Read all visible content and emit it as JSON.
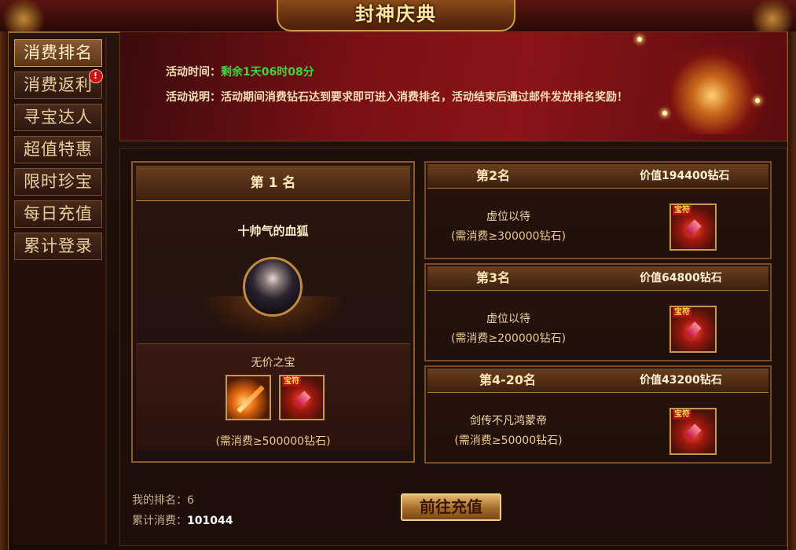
{
  "window": {
    "title": "封神庆典"
  },
  "sidebar": {
    "items": [
      {
        "label": "消费排名",
        "active": true
      },
      {
        "label": "消费返利",
        "badge": "!"
      },
      {
        "label": "寻宝达人"
      },
      {
        "label": "超值特惠"
      },
      {
        "label": "限时珍宝"
      },
      {
        "label": "每日充值"
      },
      {
        "label": "累计登录"
      }
    ]
  },
  "banner": {
    "time_label": "活动时间：",
    "time_value": "剩余1天06时08分",
    "desc_label": "活动说明：",
    "desc_value": "活动期间消费钻石达到要求即可进入消费排名，活动结束后通过邮件发放排名奖励！"
  },
  "first": {
    "rank": "第 1 名",
    "player": "十帅气的血狐",
    "treasure_label": "无价之宝",
    "requirement": "(需消费≥500000钻石)",
    "items": [
      {
        "icon": "flaming-sword-icon"
      },
      {
        "icon": "treasure-chest-icon",
        "tag": "宝符"
      }
    ]
  },
  "ranks": [
    {
      "rank": "第2名",
      "value": "价值194400钻石",
      "name": "虚位以待",
      "requirement": "(需消费≥300000钻石)",
      "icon": "treasure-chest-icon",
      "tag": "宝符"
    },
    {
      "rank": "第3名",
      "value": "价值64800钻石",
      "name": "虚位以待",
      "requirement": "(需消费≥200000钻石)",
      "icon": "treasure-chest-icon",
      "tag": "宝符"
    },
    {
      "rank": "第4-20名",
      "value": "价值43200钻石",
      "name": "剑传不凡鸿蒙帝",
      "requirement": "(需消费≥50000钻石)",
      "icon": "treasure-chest-icon",
      "tag": "宝符"
    }
  ],
  "footer": {
    "my_rank_label": "我的排名：",
    "my_rank_value": "6",
    "total_label": "累计消费：",
    "total_value": "101044",
    "recharge_button": "前往充值"
  }
}
